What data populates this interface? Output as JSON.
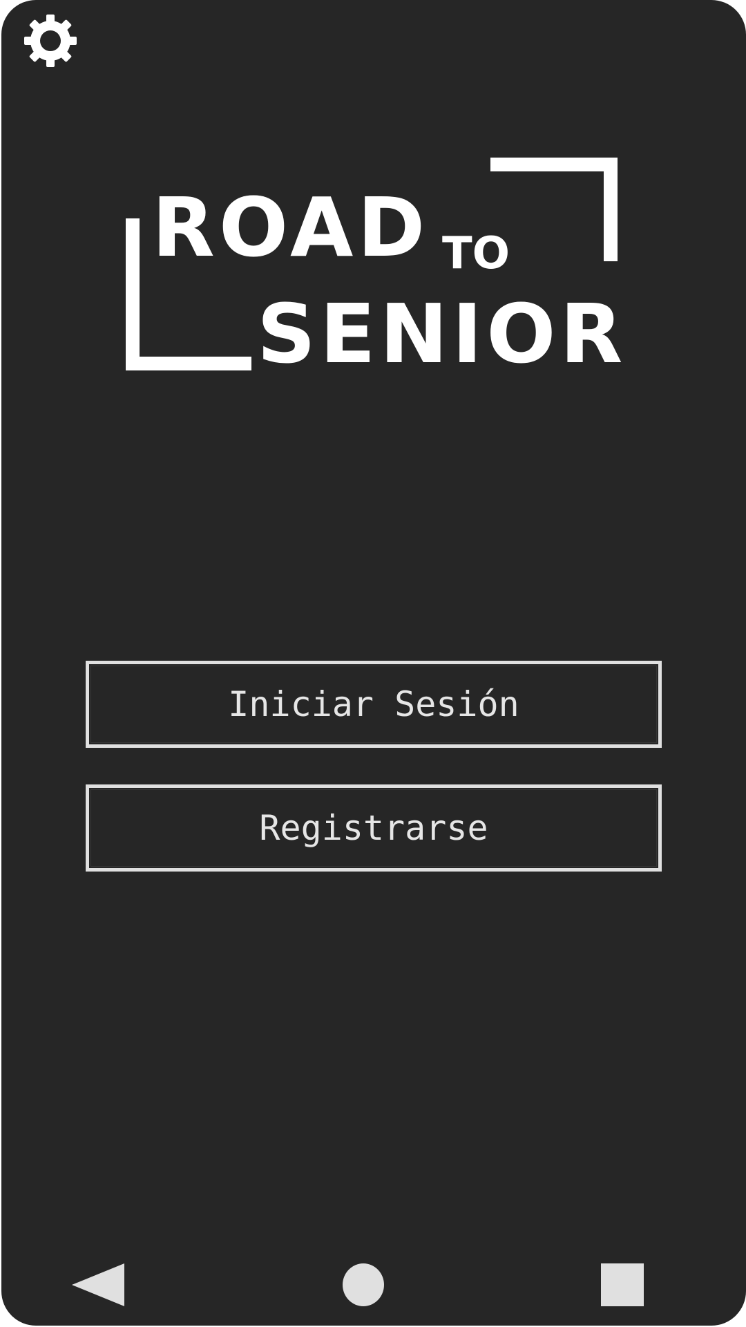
{
  "app": {
    "logo_line1": "ROAD",
    "logo_to": "TO",
    "logo_line2": "SENIOR"
  },
  "buttons": {
    "login_label": "Iniciar Sesión",
    "register_label": "Registrarse"
  },
  "icons": {
    "settings": "gear-icon",
    "back": "triangle-back-icon",
    "home": "circle-home-icon",
    "recent": "square-recent-icon"
  },
  "colors": {
    "background": "#262626",
    "foreground": "#ffffff",
    "button_border": "#e0e0e0"
  }
}
